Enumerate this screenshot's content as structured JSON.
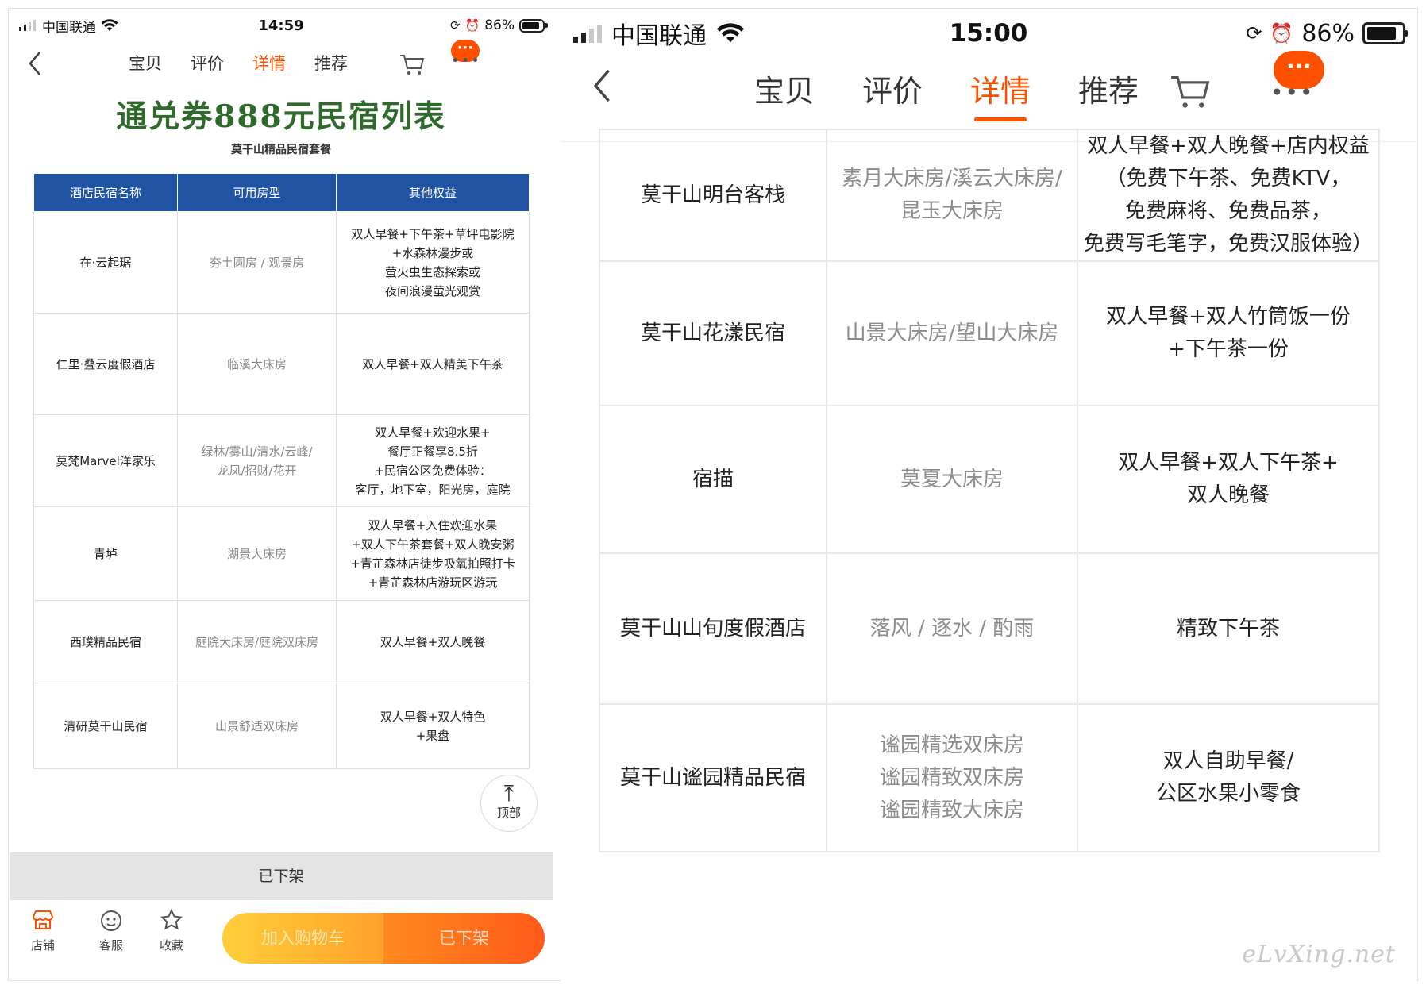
{
  "left": {
    "status": {
      "carrier": "中国联通",
      "time": "14:59",
      "battery": "86%",
      "battery_level": 0.86
    },
    "nav": {
      "tabs": [
        "宝贝",
        "评价",
        "详情",
        "推荐"
      ],
      "active_tab": "详情",
      "more_bubble": "···"
    },
    "title": "通兑券888元民宿列表",
    "subtitle": "莫干山精品民宿套餐",
    "table": {
      "headers": [
        "酒店民宿名称",
        "可用房型",
        "其他权益"
      ],
      "rows": [
        [
          "在·云起琚",
          "夯土圆房 / 观景房",
          "双人早餐+下午茶+草坪电影院\n+水森林漫步或\n萤火虫生态探索或\n夜间浪漫萤光观赏"
        ],
        [
          "仁里·叠云度假酒店",
          "临溪大床房",
          "双人早餐+双人精美下午茶"
        ],
        [
          "莫梵Marvel洋家乐",
          "绿林/雾山/清水/云峰/\n龙凤/招财/花开",
          "双人早餐+欢迎水果+\n餐厅正餐享8.5折\n+民宿公区免费体验：\n客厅，地下室，阳光房，庭院"
        ],
        [
          "青垆",
          "湖景大床房",
          "双人早餐+入住欢迎水果\n+双人下午茶套餐+双人晚安粥\n+青芷森林店徒步吸氧拍照打卡\n+青芷森林店游玩区游玩"
        ],
        [
          "西璞精品民宿",
          "庭院大床房/庭院双床房",
          "双人早餐+双人晚餐"
        ],
        [
          "清研莫干山民宿",
          "山景舒适双床房",
          "双人早餐+双人特色\n+果盘"
        ]
      ]
    },
    "to_top": "顶部",
    "off_shelf_bar": "已下架",
    "bottom": {
      "shop": "店铺",
      "service": "客服",
      "favorite": "收藏",
      "add_cart": "加入购物车",
      "buy": "已下架"
    }
  },
  "right": {
    "status": {
      "carrier": "中国联通",
      "time": "15:00",
      "battery": "86%",
      "battery_level": 0.86
    },
    "nav": {
      "tabs": [
        "宝贝",
        "评价",
        "详情",
        "推荐"
      ],
      "active_tab": "详情",
      "more_bubble": "···"
    },
    "table": {
      "rows": [
        [
          "莫干山明台客栈",
          "素月大床房/溪云大床房/\n昆玉大床房",
          "双人早餐+双人晚餐+店内权益\n（免费下午茶、免费KTV，\n免费麻将、免费品茶，\n免费写毛笔字，免费汉服体验）"
        ],
        [
          "莫干山花漾民宿",
          "山景大床房/望山大床房",
          "双人早餐+双人竹筒饭一份\n+下午茶一份"
        ],
        [
          "宿描",
          "莫夏大床房",
          "双人早餐+双人下午茶+\n双人晚餐"
        ],
        [
          "莫干山山旬度假酒店",
          "落风 / 逐水 / 酌雨",
          "精致下午茶"
        ],
        [
          "莫干山谧园精品民宿",
          "谧园精选双床房\n谧园精致双床房\n谧园精致大床房",
          "双人自助早餐/\n公区水果小零食"
        ]
      ]
    },
    "watermark": "eLvXing.net"
  }
}
